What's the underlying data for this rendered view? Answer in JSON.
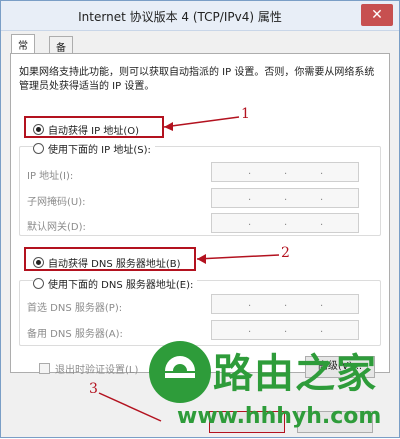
{
  "window": {
    "title": "Internet 协议版本 4 (TCP/IPv4) 属性",
    "close_icon": "close-icon"
  },
  "tabs": [
    {
      "label": "常规",
      "active": true
    },
    {
      "label": "备用配置",
      "active": false
    }
  ],
  "description": "如果网络支持此功能，则可以获取自动指派的 IP 设置。否则，你需要从网络系统管理员处获得适当的 IP 设置。",
  "ip_section": {
    "auto_label": "自动获得 IP 地址(O)",
    "manual_label": "使用下面的 IP 地址(S):",
    "auto_selected": true,
    "fields": [
      {
        "label": "IP 地址(I):",
        "value": ". . ."
      },
      {
        "label": "子网掩码(U):",
        "value": ". . ."
      },
      {
        "label": "默认网关(D):",
        "value": ". . ."
      }
    ]
  },
  "dns_section": {
    "auto_label": "自动获得 DNS 服务器地址(B)",
    "manual_label": "使用下面的 DNS 服务器地址(E):",
    "auto_selected": true,
    "fields": [
      {
        "label": "首选 DNS 服务器(P):",
        "value": ". . ."
      },
      {
        "label": "备用 DNS 服务器(A):",
        "value": ". . ."
      }
    ]
  },
  "validate_label": "退出时验证设置(L)",
  "advanced_partial": "高级(V)...",
  "callouts": {
    "one": "1",
    "two": "2",
    "three": "3"
  },
  "watermark": {
    "brand": "路由之家",
    "url": "www.hhhyh.com"
  },
  "colors": {
    "highlight": "#b3121f",
    "brand_green": "#2e9c3a"
  }
}
